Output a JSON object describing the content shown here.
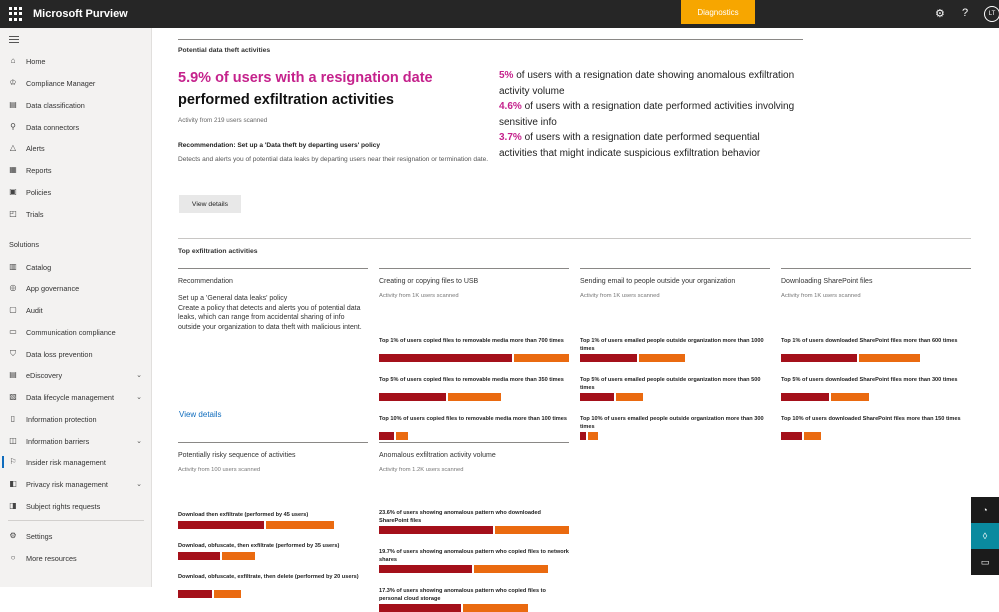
{
  "topbar": {
    "title": "Microsoft Purview",
    "diagnostics": "Diagnostics",
    "avatar": "LT"
  },
  "sidebar": {
    "items": [
      {
        "label": "Home",
        "icon": "home-icon"
      },
      {
        "label": "Compliance Manager",
        "icon": "trophy-icon"
      },
      {
        "label": "Data classification",
        "icon": "classification-icon"
      },
      {
        "label": "Data connectors",
        "icon": "connector-icon"
      },
      {
        "label": "Alerts",
        "icon": "bell-icon"
      },
      {
        "label": "Reports",
        "icon": "chart-icon"
      },
      {
        "label": "Policies",
        "icon": "policy-icon"
      },
      {
        "label": "Trials",
        "icon": "trials-icon"
      }
    ],
    "solutions_heading": "Solutions",
    "solutions": [
      {
        "label": "Catalog",
        "icon": "catalog-icon"
      },
      {
        "label": "App governance",
        "icon": "app-icon"
      },
      {
        "label": "Audit",
        "icon": "audit-icon"
      },
      {
        "label": "Communication compliance",
        "icon": "chat-icon"
      },
      {
        "label": "Data loss prevention",
        "icon": "shield-icon"
      },
      {
        "label": "eDiscovery",
        "icon": "discovery-icon"
      },
      {
        "label": "Data lifecycle management",
        "icon": "lifecycle-icon"
      },
      {
        "label": "Information protection",
        "icon": "lock-icon"
      },
      {
        "label": "Information barriers",
        "icon": "barrier-icon"
      },
      {
        "label": "Insider risk management",
        "icon": "risk-icon"
      },
      {
        "label": "Privacy risk management",
        "icon": "privacy-icon"
      },
      {
        "label": "Subject rights requests",
        "icon": "request-icon"
      }
    ],
    "settings": "Settings",
    "more": "More resources"
  },
  "theft": {
    "section": "Potential data theft activities",
    "headline_pink": "5.9% of users with a resignation date",
    "headline_black": "performed exfiltration activities",
    "activity": "Activity from 219 users scanned",
    "rec_title": "Recommendation: Set up a 'Data theft by departing users' policy",
    "rec_desc": "Detects and alerts you of potential data leaks by departing users near their resignation or termination date.",
    "view_details": "View details",
    "stats": [
      {
        "pct": "5%",
        "text": " of users with a resignation date showing anomalous exfiltration activity volume"
      },
      {
        "pct": "4.6%",
        "text": " of users with a resignation date performed activities involving sensitive info"
      },
      {
        "pct": "3.7%",
        "text": " of users with a resignation date performed sequential activities that might indicate suspicious exfiltration behavior"
      }
    ]
  },
  "top": {
    "section": "Top exfiltration activities",
    "recommendation": {
      "title": "Recommendation",
      "subtitle": "Set up a 'General data leaks' policy",
      "desc": "Create a policy that detects and alerts you of potential data leaks, which can range from accidental sharing of info outside your organization to data theft with malicious intent.",
      "link": "View details"
    },
    "usb": {
      "title": "Creating or copying files to USB",
      "sub": "Activity from 1K users scanned",
      "metrics": [
        {
          "label": "Top 1% of users copied files to removable media more than 700 times",
          "value": 0.7
        },
        {
          "label": "Top 5% of users copied files to removable media more than 350 times",
          "value": 0.35
        },
        {
          "label": "Top 10% of users copied files to removable media more than 100 times",
          "value": 0.08
        }
      ]
    },
    "email": {
      "title": "Sending email to people outside your organization",
      "sub": "Activity from 1K users scanned",
      "metrics": [
        {
          "label": "Top 1% of users emailed people outside organization more than 1000 times",
          "value": 0.3
        },
        {
          "label": "Top 5% of users emailed people outside organization more than 500 times",
          "value": 0.18
        },
        {
          "label": "Top 10% of users emailed people outside organization more than 300 times",
          "value": 0.03
        }
      ]
    },
    "sharepoint": {
      "title": "Downloading SharePoint files",
      "sub": "Activity from 1K users scanned",
      "metrics": [
        {
          "label": "Top 1% of users downloaded SharePoint files more than 600 times",
          "value": 0.4
        },
        {
          "label": "Top 5% of users downloaded SharePoint files more than 300 times",
          "value": 0.25
        },
        {
          "label": "Top 10% of users downloaded SharePoint files more than 150 times",
          "value": 0.11
        }
      ]
    },
    "sequence": {
      "title": "Potentially risky sequence of activities",
      "sub": "Activity from 100 users scanned",
      "metrics": [
        {
          "label": "Download then exfiltrate (performed by 45 users)",
          "value": 0.45
        },
        {
          "label": "Download, obfuscate, then exfiltrate (performed by 35 users)",
          "value": 0.22
        },
        {
          "label": "Download, obfuscate, exfiltrate, then delete (performed by 20 users)",
          "value": 0.18
        }
      ]
    },
    "anomalous": {
      "title": "Anomalous exfiltration activity volume",
      "sub": "Activity from 1.2K users scanned",
      "metrics": [
        {
          "label": "23.6% of users showing anomalous pattern who downloaded SharePoint files",
          "value": 0.6
        },
        {
          "label": "19.7% of users showing anomalous pattern who copied files to network shares",
          "value": 0.49
        },
        {
          "label": "17.3% of users showing anomalous pattern who copied files to personal cloud storage",
          "value": 0.43
        }
      ]
    }
  },
  "colors": {
    "accent": "#c5228c",
    "bar_dark": "#a4101a",
    "bar_orange": "#ea6a10",
    "diagnostics": "#f7a600",
    "link": "#0f6cbd"
  }
}
